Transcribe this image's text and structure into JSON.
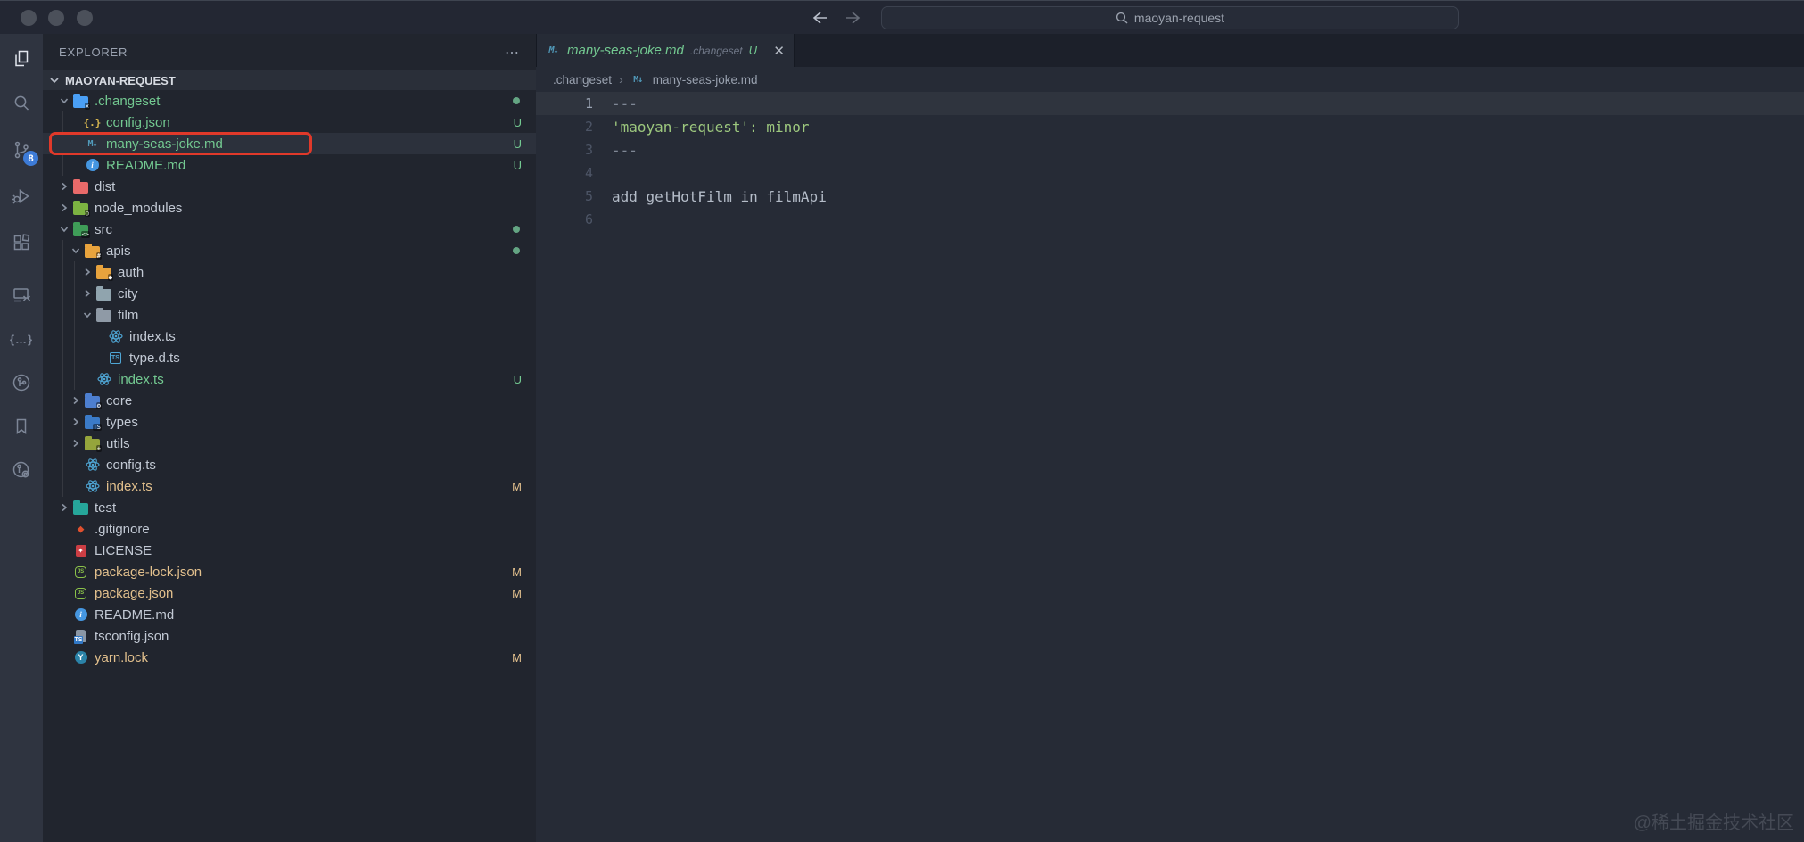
{
  "colors": {
    "green": "#73c991",
    "modified": "#e2c08d",
    "annotation_red": "#e0392a",
    "scm_badge_blue": "#3d7bd7",
    "markdown_blue": "#519aba"
  },
  "title_bar": {
    "search_text": "maoyan-request",
    "search_icon": "magnifier",
    "back_icon": "arrow-left",
    "forward_icon": "arrow-right"
  },
  "activity_bar": {
    "scm_badge": "8",
    "icons": [
      "explorer",
      "search",
      "source-control",
      "run-and-debug",
      "extensions",
      "remote-explorer",
      "braces",
      "gitlens",
      "bookmarks",
      "git-graph"
    ]
  },
  "sidebar": {
    "header": "EXPLORER",
    "more_label": "⋯",
    "section_label": "MAOYAN-REQUEST",
    "tree": [
      {
        "label": ".changeset",
        "depth": 0,
        "chevron": "down",
        "icon": "changeset-folder",
        "color": "green",
        "dot": true
      },
      {
        "label": "config.json",
        "depth": 1,
        "chevron": "",
        "icon": "json-braces",
        "color": "green",
        "git": "U"
      },
      {
        "label": "many-seas-joke.md",
        "depth": 1,
        "chevron": "",
        "icon": "markdown",
        "color": "green",
        "git": "U",
        "selected": true,
        "annotated": true
      },
      {
        "label": "README.md",
        "depth": 1,
        "chevron": "",
        "icon": "info",
        "color": "green",
        "git": "U"
      },
      {
        "label": "dist",
        "depth": 0,
        "chevron": "right",
        "icon": "dist-folder",
        "color": ""
      },
      {
        "label": "node_modules",
        "depth": 0,
        "chevron": "right",
        "icon": "node-modules-folder",
        "color": ""
      },
      {
        "label": "src",
        "depth": 0,
        "chevron": "down",
        "icon": "src-folder",
        "color": "",
        "dot": true
      },
      {
        "label": "apis",
        "depth": 1,
        "chevron": "down",
        "icon": "apis-folder",
        "color": "",
        "dot": true
      },
      {
        "label": "auth",
        "depth": 2,
        "chevron": "right",
        "icon": "auth-folder",
        "color": ""
      },
      {
        "label": "city",
        "depth": 2,
        "chevron": "right",
        "icon": "city-folder",
        "color": ""
      },
      {
        "label": "film",
        "depth": 2,
        "chevron": "down",
        "icon": "film-folder",
        "color": ""
      },
      {
        "label": "index.ts",
        "depth": 3,
        "chevron": "",
        "icon": "atom",
        "color": ""
      },
      {
        "label": "type.d.ts",
        "depth": 3,
        "chevron": "",
        "icon": "ts-def",
        "color": ""
      },
      {
        "label": "index.ts",
        "depth": 2,
        "chevron": "",
        "icon": "atom",
        "color": "green",
        "git": "U"
      },
      {
        "label": "core",
        "depth": 1,
        "chevron": "right",
        "icon": "core-folder",
        "color": ""
      },
      {
        "label": "types",
        "depth": 1,
        "chevron": "right",
        "icon": "types-folder",
        "color": ""
      },
      {
        "label": "utils",
        "depth": 1,
        "chevron": "right",
        "icon": "utils-folder",
        "color": ""
      },
      {
        "label": "config.ts",
        "depth": 1,
        "chevron": "",
        "icon": "atom",
        "color": ""
      },
      {
        "label": "index.ts",
        "depth": 1,
        "chevron": "",
        "icon": "atom",
        "color": "mod",
        "git": "M"
      },
      {
        "label": "test",
        "depth": 0,
        "chevron": "right",
        "icon": "test-folder",
        "color": ""
      },
      {
        "label": ".gitignore",
        "depth": 0,
        "chevron": "",
        "icon": "git",
        "color": ""
      },
      {
        "label": "LICENSE",
        "depth": 0,
        "chevron": "",
        "icon": "license",
        "color": ""
      },
      {
        "label": "package-lock.json",
        "depth": 0,
        "chevron": "",
        "icon": "node",
        "color": "mod",
        "git": "M"
      },
      {
        "label": "package.json",
        "depth": 0,
        "chevron": "",
        "icon": "node",
        "color": "mod",
        "git": "M"
      },
      {
        "label": "README.md",
        "depth": 0,
        "chevron": "",
        "icon": "info",
        "color": ""
      },
      {
        "label": "tsconfig.json",
        "depth": 0,
        "chevron": "",
        "icon": "tsconfig",
        "color": ""
      },
      {
        "label": "yarn.lock",
        "depth": 0,
        "chevron": "",
        "icon": "yarn",
        "color": "mod",
        "git": "M"
      }
    ]
  },
  "tab": {
    "name": "many-seas-joke.md",
    "dir": ".changeset",
    "git": "U",
    "close": "✕",
    "icon": "markdown"
  },
  "breadcrumb": {
    "dir": ".changeset",
    "sep": "›",
    "file": "many-seas-joke.md",
    "file_icon": "markdown"
  },
  "editor": {
    "lines": [
      {
        "n": "1",
        "text": "---",
        "tone": "dim",
        "active": true
      },
      {
        "n": "2",
        "text": "'maoyan-request': minor",
        "tone": "green"
      },
      {
        "n": "3",
        "text": "---",
        "tone": "dim"
      },
      {
        "n": "4",
        "text": "",
        "tone": "default"
      },
      {
        "n": "5",
        "text": "add getHotFilm in filmApi",
        "tone": "default"
      },
      {
        "n": "6",
        "text": "",
        "tone": "default"
      }
    ]
  },
  "watermark": "@稀土掘金技术社区"
}
